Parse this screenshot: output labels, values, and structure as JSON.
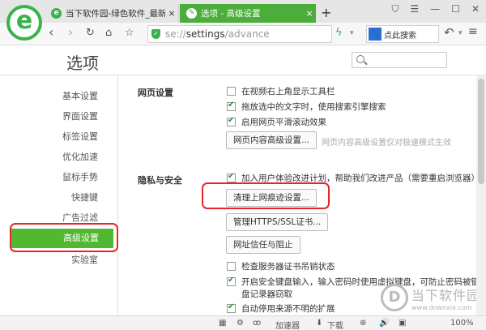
{
  "browser": {
    "logo_letter": "e",
    "tabs": [
      {
        "title": "当下软件园-绿色软件_最新绿色下",
        "icon": "e",
        "close": "×",
        "active": false
      },
      {
        "title": "选项 - 高级设置",
        "icon": "✎",
        "close": "×",
        "active": true
      }
    ],
    "new_tab": "+",
    "window_controls": [
      "⛉",
      "☰",
      "—",
      "☐",
      "✕"
    ]
  },
  "navbar": {
    "back": "‹",
    "forward": "›",
    "reload": "↻",
    "home": "⌂",
    "star": "☆",
    "url_prefix": "se://",
    "url_main": "settings",
    "url_suffix": "/advance",
    "lightning": "ϟ",
    "search_placeholder": "点此搜索",
    "search_engine_icon": "🐾",
    "undo": "↶",
    "menu": "≡"
  },
  "settings": {
    "title": "选项",
    "search_value": ""
  },
  "sidebar": {
    "items": [
      {
        "label": "基本设置",
        "active": false
      },
      {
        "label": "界面设置",
        "active": false
      },
      {
        "label": "标签设置",
        "active": false
      },
      {
        "label": "优化加速",
        "active": false
      },
      {
        "label": "鼠标手势",
        "active": false
      },
      {
        "label": "快捷键",
        "active": false
      },
      {
        "label": "广告过滤",
        "active": false
      },
      {
        "label": "高级设置",
        "active": true
      },
      {
        "label": "实验室",
        "active": false
      }
    ]
  },
  "content": {
    "web_settings": {
      "label": "网页设置",
      "options": [
        {
          "label": "在视频右上角显示工具栏",
          "checked": false
        },
        {
          "label": "拖放选中的文字时，使用搜索引擎搜索",
          "checked": true
        },
        {
          "label": "启用网页平滑滚动效果",
          "checked": true
        }
      ],
      "button": "网页内容高级设置...",
      "hint": "网页内容高级设置仅对极速模式生效"
    },
    "privacy": {
      "label": "隐私与安全",
      "ux_option": {
        "label": "加入用户体验改进计划，帮助我们改进产品（需要重启浏览器）",
        "checked": true
      },
      "buttons": [
        "清理上网痕迹设置...",
        "管理HTTPS/SSL证书...",
        "网址信任与阻止"
      ],
      "options": [
        {
          "label": "检查服务器证书吊销状态",
          "checked": false
        },
        {
          "label": "开启安全键盘输入，输入密码时使用虚拟键盘，可防止密码被键",
          "continuation": "盘记录器窃取",
          "checked": true
        },
        {
          "label": "自动停用来源不明的扩展",
          "checked": true
        }
      ]
    }
  },
  "watermark": {
    "logo": "D",
    "cn": "当下软件园",
    "en": "www.downxia.com"
  },
  "statusbar": {
    "accelerator": "加速器",
    "download": "下载",
    "zoom": "100%",
    "icons": [
      "▦",
      "⚙",
      "ꝏ",
      "⬇",
      "⊕",
      "🔊",
      "▣"
    ]
  }
}
